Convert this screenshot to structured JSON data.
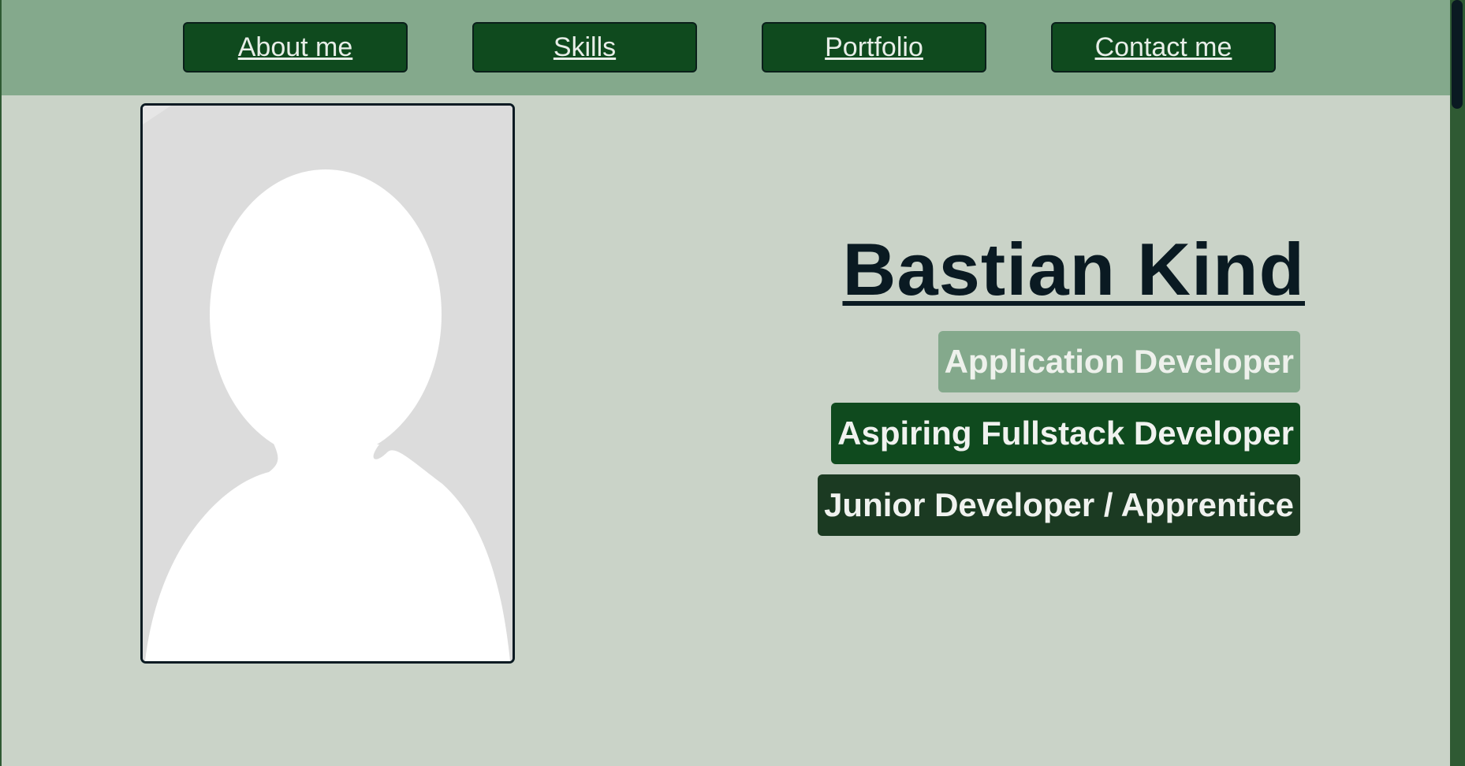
{
  "nav": {
    "items": [
      {
        "label": "About me"
      },
      {
        "label": "Skills"
      },
      {
        "label": "Portfolio"
      },
      {
        "label": "Contact me"
      }
    ]
  },
  "profile": {
    "photo_icon": "avatar-placeholder-icon",
    "name": "Bastian Kind",
    "roles": [
      {
        "label": "Application Developer"
      },
      {
        "label": "Aspiring Fullstack Developer"
      },
      {
        "label": "Junior Developer / Apprentice"
      }
    ]
  },
  "colors": {
    "header_bg": "#84a98c",
    "page_bg": "#cad3c8",
    "button_bg": "#0f4a1e",
    "dark_text": "#0a1a22"
  }
}
